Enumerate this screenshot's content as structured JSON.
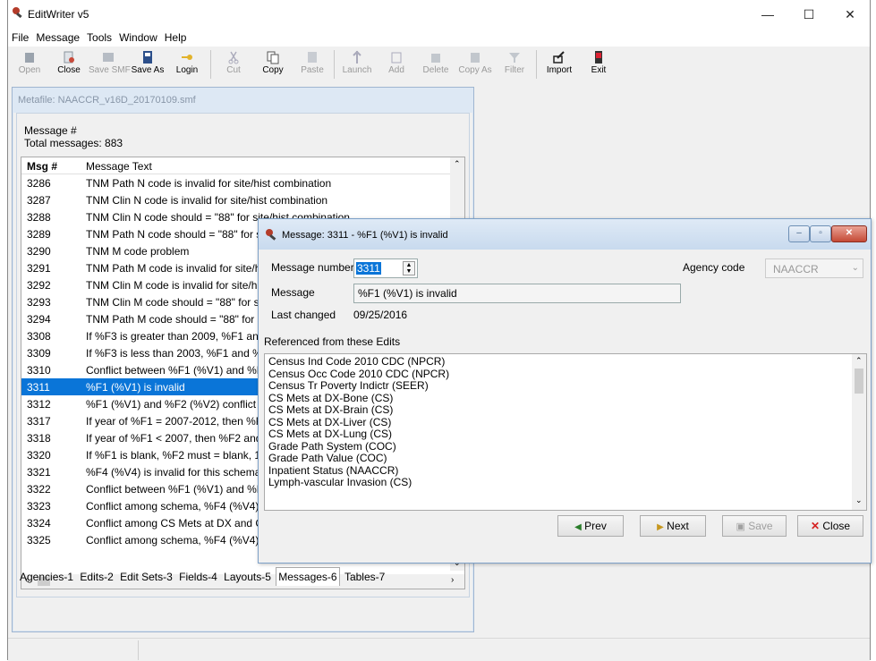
{
  "app": {
    "title": "EditWriter v5"
  },
  "window_controls": {
    "minimize": "—",
    "maximize": "☐",
    "close": "✕"
  },
  "menu": [
    "File",
    "Message",
    "Tools",
    "Window",
    "Help"
  ],
  "toolbar": {
    "open": "Open",
    "close": "Close",
    "save_smf": "Save SMF",
    "save_as": "Save As",
    "login": "Login",
    "cut": "Cut",
    "copy": "Copy",
    "paste": "Paste",
    "launch": "Launch",
    "add": "Add",
    "delete": "Delete",
    "copy_as": "Copy As",
    "filter": "Filter",
    "import": "Import",
    "exit": "Exit"
  },
  "metafile": {
    "caption": "Metafile: NAACCR_v16D_20170109.smf",
    "message_label": "Message #",
    "total_label": "Total messages: 883",
    "col_num": "Msg #",
    "col_text": "Message Text",
    "rows": [
      {
        "num": "3286",
        "text": "TNM Path N code is invalid for site/hist combination"
      },
      {
        "num": "3287",
        "text": "TNM Clin N code is invalid for site/hist combination"
      },
      {
        "num": "3288",
        "text": "TNM Clin N code should = \"88\" for site/hist combination"
      },
      {
        "num": "3289",
        "text": "TNM Path N code should = \"88\" for site/hist combination"
      },
      {
        "num": "3290",
        "text": "TNM M code problem"
      },
      {
        "num": "3291",
        "text": "TNM Path M code is invalid for site/hist combination"
      },
      {
        "num": "3292",
        "text": "TNM Clin M code is invalid for site/hist combination"
      },
      {
        "num": "3293",
        "text": "TNM Clin M code should = \"88\" for site/hist combination"
      },
      {
        "num": "3294",
        "text": "TNM Path M code should = \"88\" for site/hist combination"
      },
      {
        "num": "3308",
        "text": "If %F3 is greater than 2009, %F1 and %F2 must be blank"
      },
      {
        "num": "3309",
        "text": "If %F3 is less than 2003, %F1 and %F2 must be blank"
      },
      {
        "num": "3310",
        "text": "Conflict between %F1 (%V1) and %F2 (%V2)"
      },
      {
        "num": "3311",
        "text": "%F1 (%V1) is invalid"
      },
      {
        "num": "3312",
        "text": "%F1 (%V1) and %F2 (%V2) conflict"
      },
      {
        "num": "3317",
        "text": "If year of %F1 = 2007-2012, then %F2 must not be blank"
      },
      {
        "num": "3318",
        "text": "If year of %F1 < 2007, then %F2 and %F3 must be blank"
      },
      {
        "num": "3320",
        "text": "If %F1 is blank, %F2 must = blank, 1, or 9"
      },
      {
        "num": "3321",
        "text": "%F4 (%V4) is invalid for this schema"
      },
      {
        "num": "3322",
        "text": "Conflict between %F1 (%V1) and %F2 (%V2)"
      },
      {
        "num": "3323",
        "text": "Conflict among schema, %F4 (%V4), %F5 (%V5)"
      },
      {
        "num": "3324",
        "text": "Conflict among CS Mets at DX and CS Mets fields"
      },
      {
        "num": "3325",
        "text": "Conflict among schema, %F4 (%V4), %F5 (%V5)"
      }
    ],
    "tabs": [
      "Agencies-1",
      "Edits-2",
      "Edit Sets-3",
      "Fields-4",
      "Layouts-5",
      "Messages-6",
      "Tables-7"
    ]
  },
  "dialog": {
    "caption": "Message: 3311 - %F1 (%V1) is invalid",
    "msgnum_label": "Message number",
    "msgnum_value": "3311",
    "agency_label": "Agency code",
    "agency_value": "NAACCR",
    "message_label": "Message",
    "message_value": "%F1 (%V1) is invalid",
    "changed_label": "Last changed",
    "changed_value": "09/25/2016",
    "ref_label": "Referenced from these Edits",
    "refs": [
      "Census Ind Code 2010 CDC (NPCR)",
      "Census Occ Code 2010 CDC (NPCR)",
      "Census Tr Poverty Indictr (SEER)",
      "CS Mets at DX-Bone (CS)",
      "CS Mets at DX-Brain (CS)",
      "CS Mets at DX-Liver (CS)",
      "CS Mets at DX-Lung (CS)",
      "Grade Path System (COC)",
      "Grade Path Value (COC)",
      "Inpatient Status (NAACCR)",
      "Lymph-vascular Invasion (CS)"
    ],
    "prev": "Prev",
    "next": "Next",
    "save": "Save",
    "close": "Close"
  }
}
